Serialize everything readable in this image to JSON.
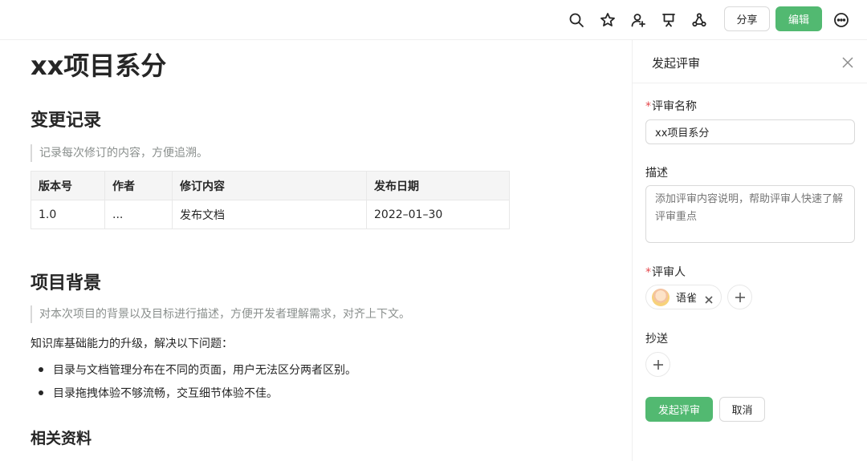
{
  "toolbar": {
    "icons": [
      "search-icon",
      "star-icon",
      "add-user-icon",
      "presentation-icon",
      "share-network-icon",
      "more-icon"
    ],
    "share_label": "分享",
    "edit_label": "编辑"
  },
  "doc": {
    "title": "xx项目系分",
    "sections": {
      "changelog": {
        "heading": "变更记录",
        "quote": "记录每次修订的内容，方便追溯。",
        "table": {
          "headers": [
            "版本号",
            "作者",
            "修订内容",
            "发布日期"
          ],
          "rows": [
            [
              "1.0",
              "...",
              "发布文档",
              "2022–01–30"
            ]
          ]
        }
      },
      "background": {
        "heading": "项目背景",
        "quote": "对本次项目的背景以及目标进行描述，方便开发者理解需求，对齐上下文。",
        "intro": "知识库基础能力的升级，解决以下问题：",
        "bullets": [
          "目录与文档管理分布在不同的页面，用户无法区分两者区别。",
          "目录拖拽体验不够流畅，交互细节体验不佳。"
        ]
      },
      "references": {
        "heading": "相关资料"
      }
    }
  },
  "panel": {
    "title": "发起评审",
    "name_label": "评审名称",
    "name_value": "xx项目系分",
    "desc_label": "描述",
    "desc_placeholder": "添加评审内容说明，帮助评审人快速了解评审重点",
    "reviewer_label": "评审人",
    "reviewers": [
      {
        "name": "语雀"
      }
    ],
    "cc_label": "抄送",
    "submit_label": "发起评审",
    "cancel_label": "取消",
    "required_mark": "*",
    "accent_color": "#52b971",
    "required_color": "#e5484d"
  }
}
